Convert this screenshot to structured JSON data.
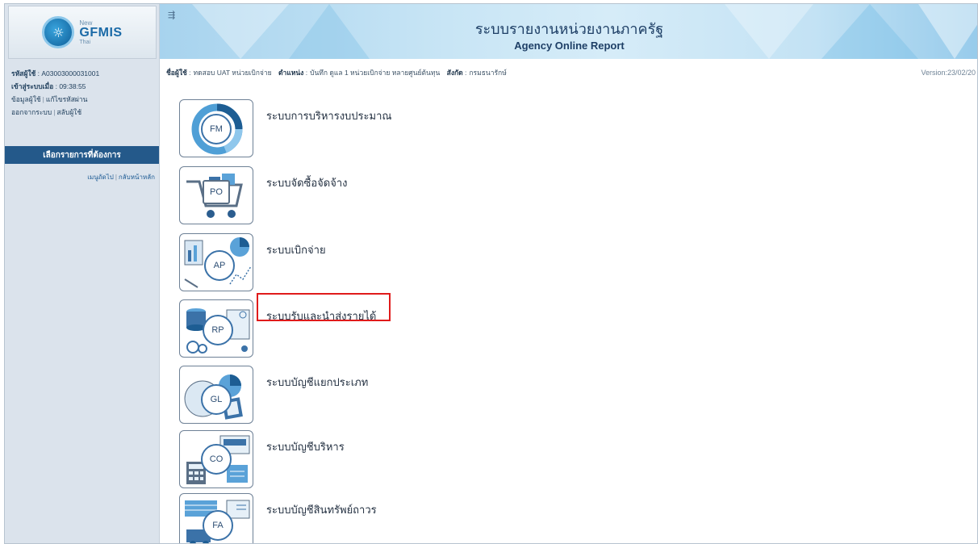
{
  "sidebar": {
    "logo": {
      "new": "New",
      "name": "GFMIS",
      "sub": "Thai"
    },
    "user_id_label": "รหัสผู้ใช้",
    "user_id": "A03003000031001",
    "login_time_label": "เข้าสู่ระบบเมื่อ",
    "login_time": "09:38:55",
    "links_row1": [
      "ข้อมูลผู้ใช้",
      "แก้ไขรหัสผ่าน"
    ],
    "links_row2": [
      "ออกจากระบบ",
      "สลับผู้ใช้"
    ],
    "menu_header": "เลือกรายการที่ต้องการ",
    "menu_links": [
      "เมนูถัดไป",
      "กลับหน้าหลัก"
    ]
  },
  "header": {
    "title_th": "ระบบรายงานหน่วยงานภาครัฐ",
    "title_en": "Agency Online Report",
    "toggle_icon": "⇶"
  },
  "infobar": {
    "user_label": "ชื่อผู้ใช้",
    "user_value": "ทดสอบ UAT หน่วยเบิกจ่าย",
    "position_label": "ตำแหน่ง",
    "position_value": "บันทึก ดูแล 1 หน่วยเบิกจ่าย หลายศูนย์ต้นทุน",
    "affiliation_label": "สังกัด",
    "affiliation_value": "กรมธนารักษ์",
    "version": "Version:23/02/20"
  },
  "systems": [
    {
      "code": "FM",
      "label": "ระบบการบริหารงบประมาณ",
      "icon": "budget-chart-icon",
      "highlighted": false
    },
    {
      "code": "PO",
      "label": "ระบบจัดซื้อจัดจ้าง",
      "icon": "shopping-cart-icon",
      "highlighted": false
    },
    {
      "code": "AP",
      "label": "ระบบเบิกจ่าย",
      "icon": "payment-chart-icon",
      "highlighted": false
    },
    {
      "code": "RP",
      "label": "ระบบรับและนำส่งรายได้",
      "icon": "revenue-coins-icon",
      "highlighted": true
    },
    {
      "code": "GL",
      "label": "ระบบบัญชีแยกประเภท",
      "icon": "ledger-icon",
      "highlighted": false
    },
    {
      "code": "CO",
      "label": "ระบบบัญชีบริหาร",
      "icon": "calculator-icon",
      "highlighted": false
    },
    {
      "code": "FA",
      "label": "ระบบบัญชีสินทรัพย์ถาวร",
      "icon": "fixed-asset-icon",
      "highlighted": false
    }
  ],
  "colors": {
    "sidebar_bg": "#dbe3ec",
    "menu_header_bg": "#24598a",
    "highlight": "#e01b1b",
    "banner": "#c8e5f5"
  }
}
